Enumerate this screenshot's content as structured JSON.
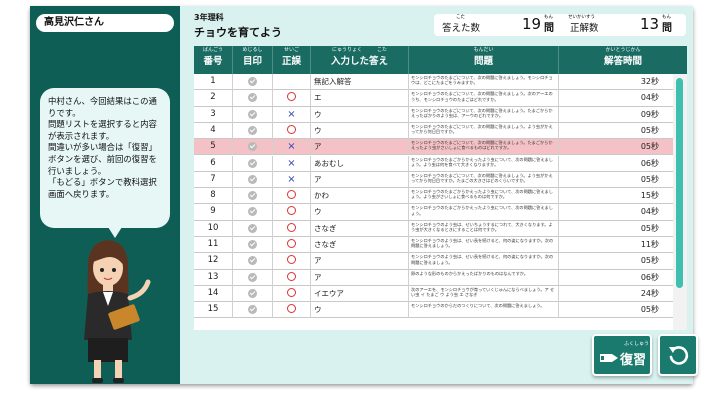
{
  "user": {
    "name": "高見沢仁さん"
  },
  "bubble": {
    "lines": [
      "中村さん、今回結果はこの通りです。",
      "問題リストを選択すると内容が表示されます。",
      "間違いが多い場合は「復習」ボタンを選び、前回の復習を行いましょう。",
      "「もどる」ボタンで教科選択画面へ戻ります。"
    ]
  },
  "header": {
    "subject": "3年理科",
    "title": "チョウを育てよう"
  },
  "counts": {
    "answered_label": "答えた数",
    "answered_ruby": "こた",
    "answered_value": "19",
    "answered_unit": "問",
    "unit_ruby": "もん",
    "correct_label": "正解数",
    "correct_ruby": "せいかいすう",
    "correct_value": "13",
    "correct_unit": "問"
  },
  "table": {
    "columns": [
      {
        "label": "番号",
        "ruby": "ばんごう"
      },
      {
        "label": "目印",
        "ruby": "めじるし"
      },
      {
        "label": "正誤",
        "ruby": "せいご"
      },
      {
        "label": "入力した答え",
        "ruby": "にゅうりょく　　　こた"
      },
      {
        "label": "問題",
        "ruby": "もんだい"
      },
      {
        "label": "解答時間",
        "ruby": "かいとうじかん"
      }
    ],
    "rows": [
      {
        "no": "1",
        "result": "",
        "answer": "無記入解答",
        "question": "モンシロチョウのたまごについて、次の問題に答えましょう。モンシロチョウは、どこにたまごをうみますか。",
        "time": "32秒"
      },
      {
        "no": "2",
        "result": "maru",
        "answer": "エ",
        "question": "モンシロチョウのたまごについて、次の問題に答えましょう。次のア〜エのうち、モンシロチョウのたまごはどれですか。",
        "time": "04秒"
      },
      {
        "no": "3",
        "result": "batsu",
        "answer": "ウ",
        "question": "モンシロチョウのたまごについて、次の問題に答えましょう。たまごからかえったばかりのよう虫は、ア〜ウのどれですか。",
        "time": "09秒"
      },
      {
        "no": "4",
        "result": "maru",
        "answer": "ウ",
        "question": "モンシロチョウのたまごについて、次の問題に答えましょう。よう虫がかえってから何日目ですか。",
        "time": "05秒"
      },
      {
        "no": "5",
        "result": "batsu",
        "answer": "ア",
        "question": "モンシロチョウのたまごについて、次の問題に答えましょう。たまごからかえったよう虫がさいしょに食べるものはどれですか。",
        "time": "05秒"
      },
      {
        "no": "6",
        "result": "batsu",
        "answer": "あおむし",
        "question": "モンシロチョウのたまごからかえったよう虫について、次の問題に答えましょう。よう虫は何を食べて大きくなりますか。",
        "time": "06秒"
      },
      {
        "no": "7",
        "result": "batsu",
        "answer": "ア",
        "question": "モンシロチョウのたまごについて、次の問題に答えましょう。よう虫がかえってから何日目ですか。たまごの大きさはどのくらいですか。",
        "time": "05秒"
      },
      {
        "no": "8",
        "result": "maru",
        "answer": "かわ",
        "question": "モンシロチョウのたまごからかえったよう虫について、次の問題に答えましょう。よう虫がさいしょに食べるものは何ですか。",
        "time": "15秒"
      },
      {
        "no": "9",
        "result": "maru",
        "answer": "ウ",
        "question": "モンシロチョウのたまごからかえったよう虫について、次の問題に答えましょう。",
        "time": "04秒"
      },
      {
        "no": "10",
        "result": "maru",
        "answer": "さなぎ",
        "question": "モンシロチョウのよう虫は、せいちょうするにつれて、大きくなります。よう虫が大きくなるときにすることは何ですか。",
        "time": "05秒"
      },
      {
        "no": "11",
        "result": "maru",
        "answer": "さなぎ",
        "question": "モンシロチョウのよう虫は、せい長を続けると、何の姿になりますか。次の問題に答えましょう。",
        "time": "11秒"
      },
      {
        "no": "12",
        "result": "maru",
        "answer": "ア",
        "question": "モンシロチョウのよう虫は、せい長を続けると、何の姿になりますか。次の問題に答えましょう。",
        "time": "05秒"
      },
      {
        "no": "13",
        "result": "maru",
        "answer": "ア",
        "question": "卵のような形のものからかえったばかりのものはなんですか。",
        "time": "06秒"
      },
      {
        "no": "14",
        "result": "maru",
        "answer": "イエウア",
        "question": "次のア〜エを、モンシロチョウが育っていくじゅんにならべましょう。ア せい虫 イ たまご ウ よう虫 エ さなぎ",
        "time": "24秒"
      },
      {
        "no": "15",
        "result": "maru",
        "answer": "ウ",
        "question": "モンシロチョウのからだのつくりについて、次の問題に答えましょう。",
        "time": "05秒"
      }
    ]
  },
  "buttons": {
    "review_label": "復習",
    "review_ruby": "ふくしゅう",
    "back_icon": "back-arrow-icon"
  },
  "colors": {
    "frame": "#0f5e55",
    "header": "#1a6b62",
    "selected_row": "#f4c2c6",
    "accent": "#3fbfae"
  }
}
